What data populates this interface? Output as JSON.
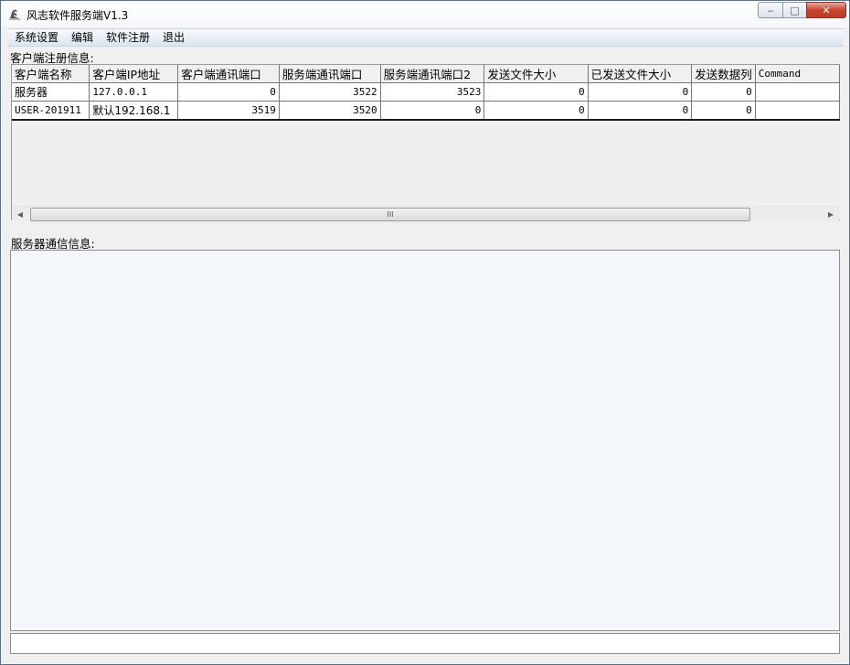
{
  "window": {
    "title": "风志软件服务端V1.3",
    "controls": {
      "minimize": "‒",
      "maximize": "□",
      "close": "✕"
    }
  },
  "menu": [
    {
      "label": "系统设置"
    },
    {
      "label": "编辑"
    },
    {
      "label": "软件注册"
    },
    {
      "label": "退出"
    }
  ],
  "client_section": {
    "label": "客户端注册信息:",
    "columns": [
      "客户端名称",
      "客户端IP地址",
      "客户端通讯端口",
      "服务端通讯端口",
      "服务端通讯端口2",
      "发送文件大小",
      "已发送文件大小",
      "发送数据列",
      "Command"
    ],
    "rows": [
      [
        "服务器",
        "127.0.0.1",
        "0",
        "3522",
        "3523",
        "0",
        "0",
        "0",
        ""
      ],
      [
        "USER-201911",
        "默认192.168.1",
        "3519",
        "3520",
        "0",
        "0",
        "0",
        "0",
        ""
      ]
    ]
  },
  "scrollbar": {
    "grip": "III",
    "left_arrow": "◀",
    "right_arrow": "▶"
  },
  "log_section": {
    "label": "服务器通信信息:",
    "content": ""
  },
  "command_input": {
    "value": ""
  }
}
